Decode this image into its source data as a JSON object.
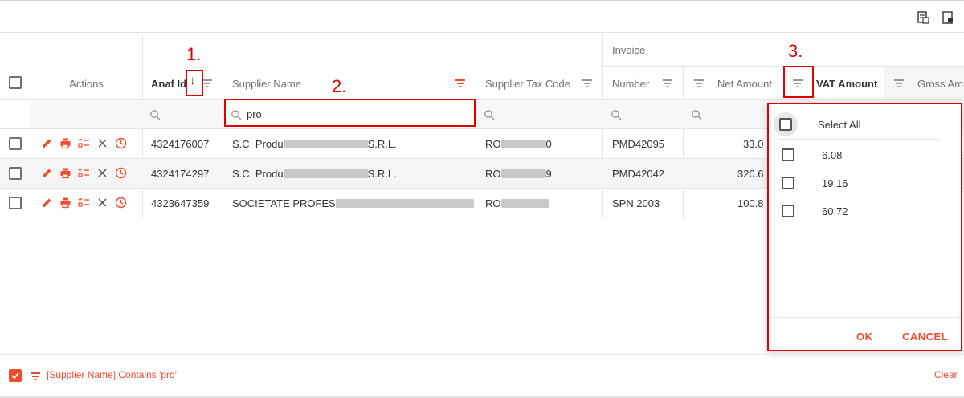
{
  "toolbar": {
    "icons": [
      "export-icon",
      "column-chooser-icon"
    ]
  },
  "header": {
    "actions": "Actions",
    "anaf_id": "Anaf Id",
    "sort_arrow": "↓",
    "supplier_name": "Supplier Name",
    "supplier_tax_code": "Supplier Tax Code",
    "invoice_group": "Invoice",
    "number": "Number",
    "net_amount": "Net Amount",
    "vat_amount": "VAT Amount",
    "gross_amount": "Gross Am"
  },
  "filter_row": {
    "supplier_name_value": "pro"
  },
  "rows": [
    {
      "anaf_id": "4324176007",
      "supplier_prefix": "S.C. Produ",
      "supplier_suffix": "S.R.L.",
      "tax_prefix": "RO",
      "tax_suffix": "0",
      "number": "PMD42095",
      "net_amount": "33.0"
    },
    {
      "anaf_id": "4324174297",
      "supplier_prefix": "S.C. Produ",
      "supplier_suffix": "S.R.L.",
      "tax_prefix": "RO",
      "tax_suffix": "9",
      "number": "PMD42042",
      "net_amount": "320.6"
    },
    {
      "anaf_id": "4323647359",
      "supplier_prefix": "SOCIETATE PROFES",
      "supplier_suffix": "",
      "tax_prefix": "RO",
      "tax_suffix": "",
      "number": "SPN 2003",
      "net_amount": "100.8"
    }
  ],
  "popup": {
    "select_all": "Select All",
    "options": [
      "6.08",
      "19.16",
      "60.72"
    ],
    "ok": "OK",
    "cancel": "CANCEL"
  },
  "footer": {
    "filter_expression": "[Supplier Name] Contains 'pro'",
    "clear": "Clear"
  },
  "annotations": [
    "1.",
    "2.",
    "3."
  ],
  "colors": {
    "accent": "#ee4c2c",
    "annotation": "#e00000"
  }
}
